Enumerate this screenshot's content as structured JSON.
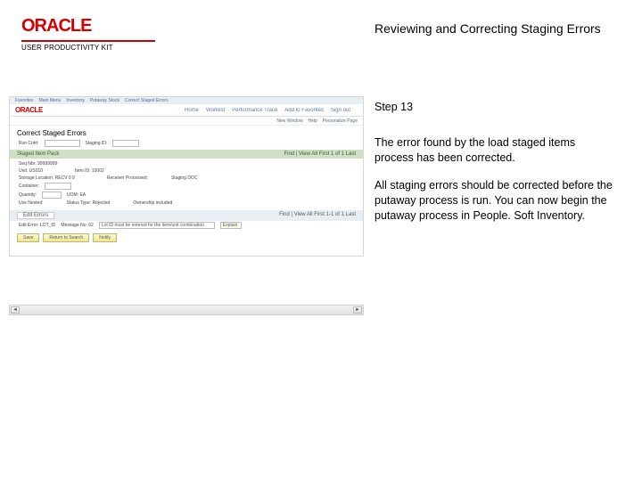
{
  "brand": {
    "logo_text": "ORACLE",
    "subtitle": "USER PRODUCTIVITY KIT"
  },
  "page_title": "Reviewing and Correcting Staging Errors",
  "notes": {
    "step": "Step 13",
    "para1": "The error found by the load staged items process has been corrected.",
    "para2": "All staging errors should be corrected before the putaway process is run. You can now begin the putaway process in People. Soft Inventory."
  },
  "shot": {
    "menu": [
      "Home",
      "Worklist",
      "Performance Trace",
      "Add to Favorites",
      "Sign out"
    ],
    "oracle": "ORACLE",
    "sub2": [
      "New Window",
      "Help",
      "Personalize Page"
    ],
    "crumbs": [
      "Favorites",
      "Main Menu",
      "Inventory",
      "Putaway Stock",
      "Correct Staged Errors"
    ],
    "title": "Correct Staged Errors",
    "summary_l": "Run Cntrl:",
    "summary_r": "Staging ID:",
    "band_l": "Staged Item Pack",
    "band_r": "Find | View All    First 1 of 1 Last",
    "fields": {
      "seq": "Seq Nbr: 99999999",
      "unit": "Unit: US010",
      "item": "Item ID: 10002",
      "loc": "Storage Location: RECV 0 9",
      "container": "Container:",
      "recv": "Receiver Processed:",
      "stg": "Staging DOC",
      "qty": "Quantity:",
      "uom": "UOM: EA",
      "nested": "Use Nested:",
      "status": "Status Type: Rejected",
      "ownership": "Ownership included"
    },
    "band2_tab": "Edit Errors",
    "band2_more": "Find | View All    First 1-1 of 1 Last",
    "err": {
      "code": "Edit Error: LOT_ID",
      "msg": "Message No: 62",
      "text": "Lot ID must be entered for the item/unit combination.",
      "btn": "Explain"
    },
    "foot": [
      "Save",
      "Return to Search",
      "Notify"
    ]
  },
  "hscroll": {
    "left": "◄",
    "right": "►"
  }
}
